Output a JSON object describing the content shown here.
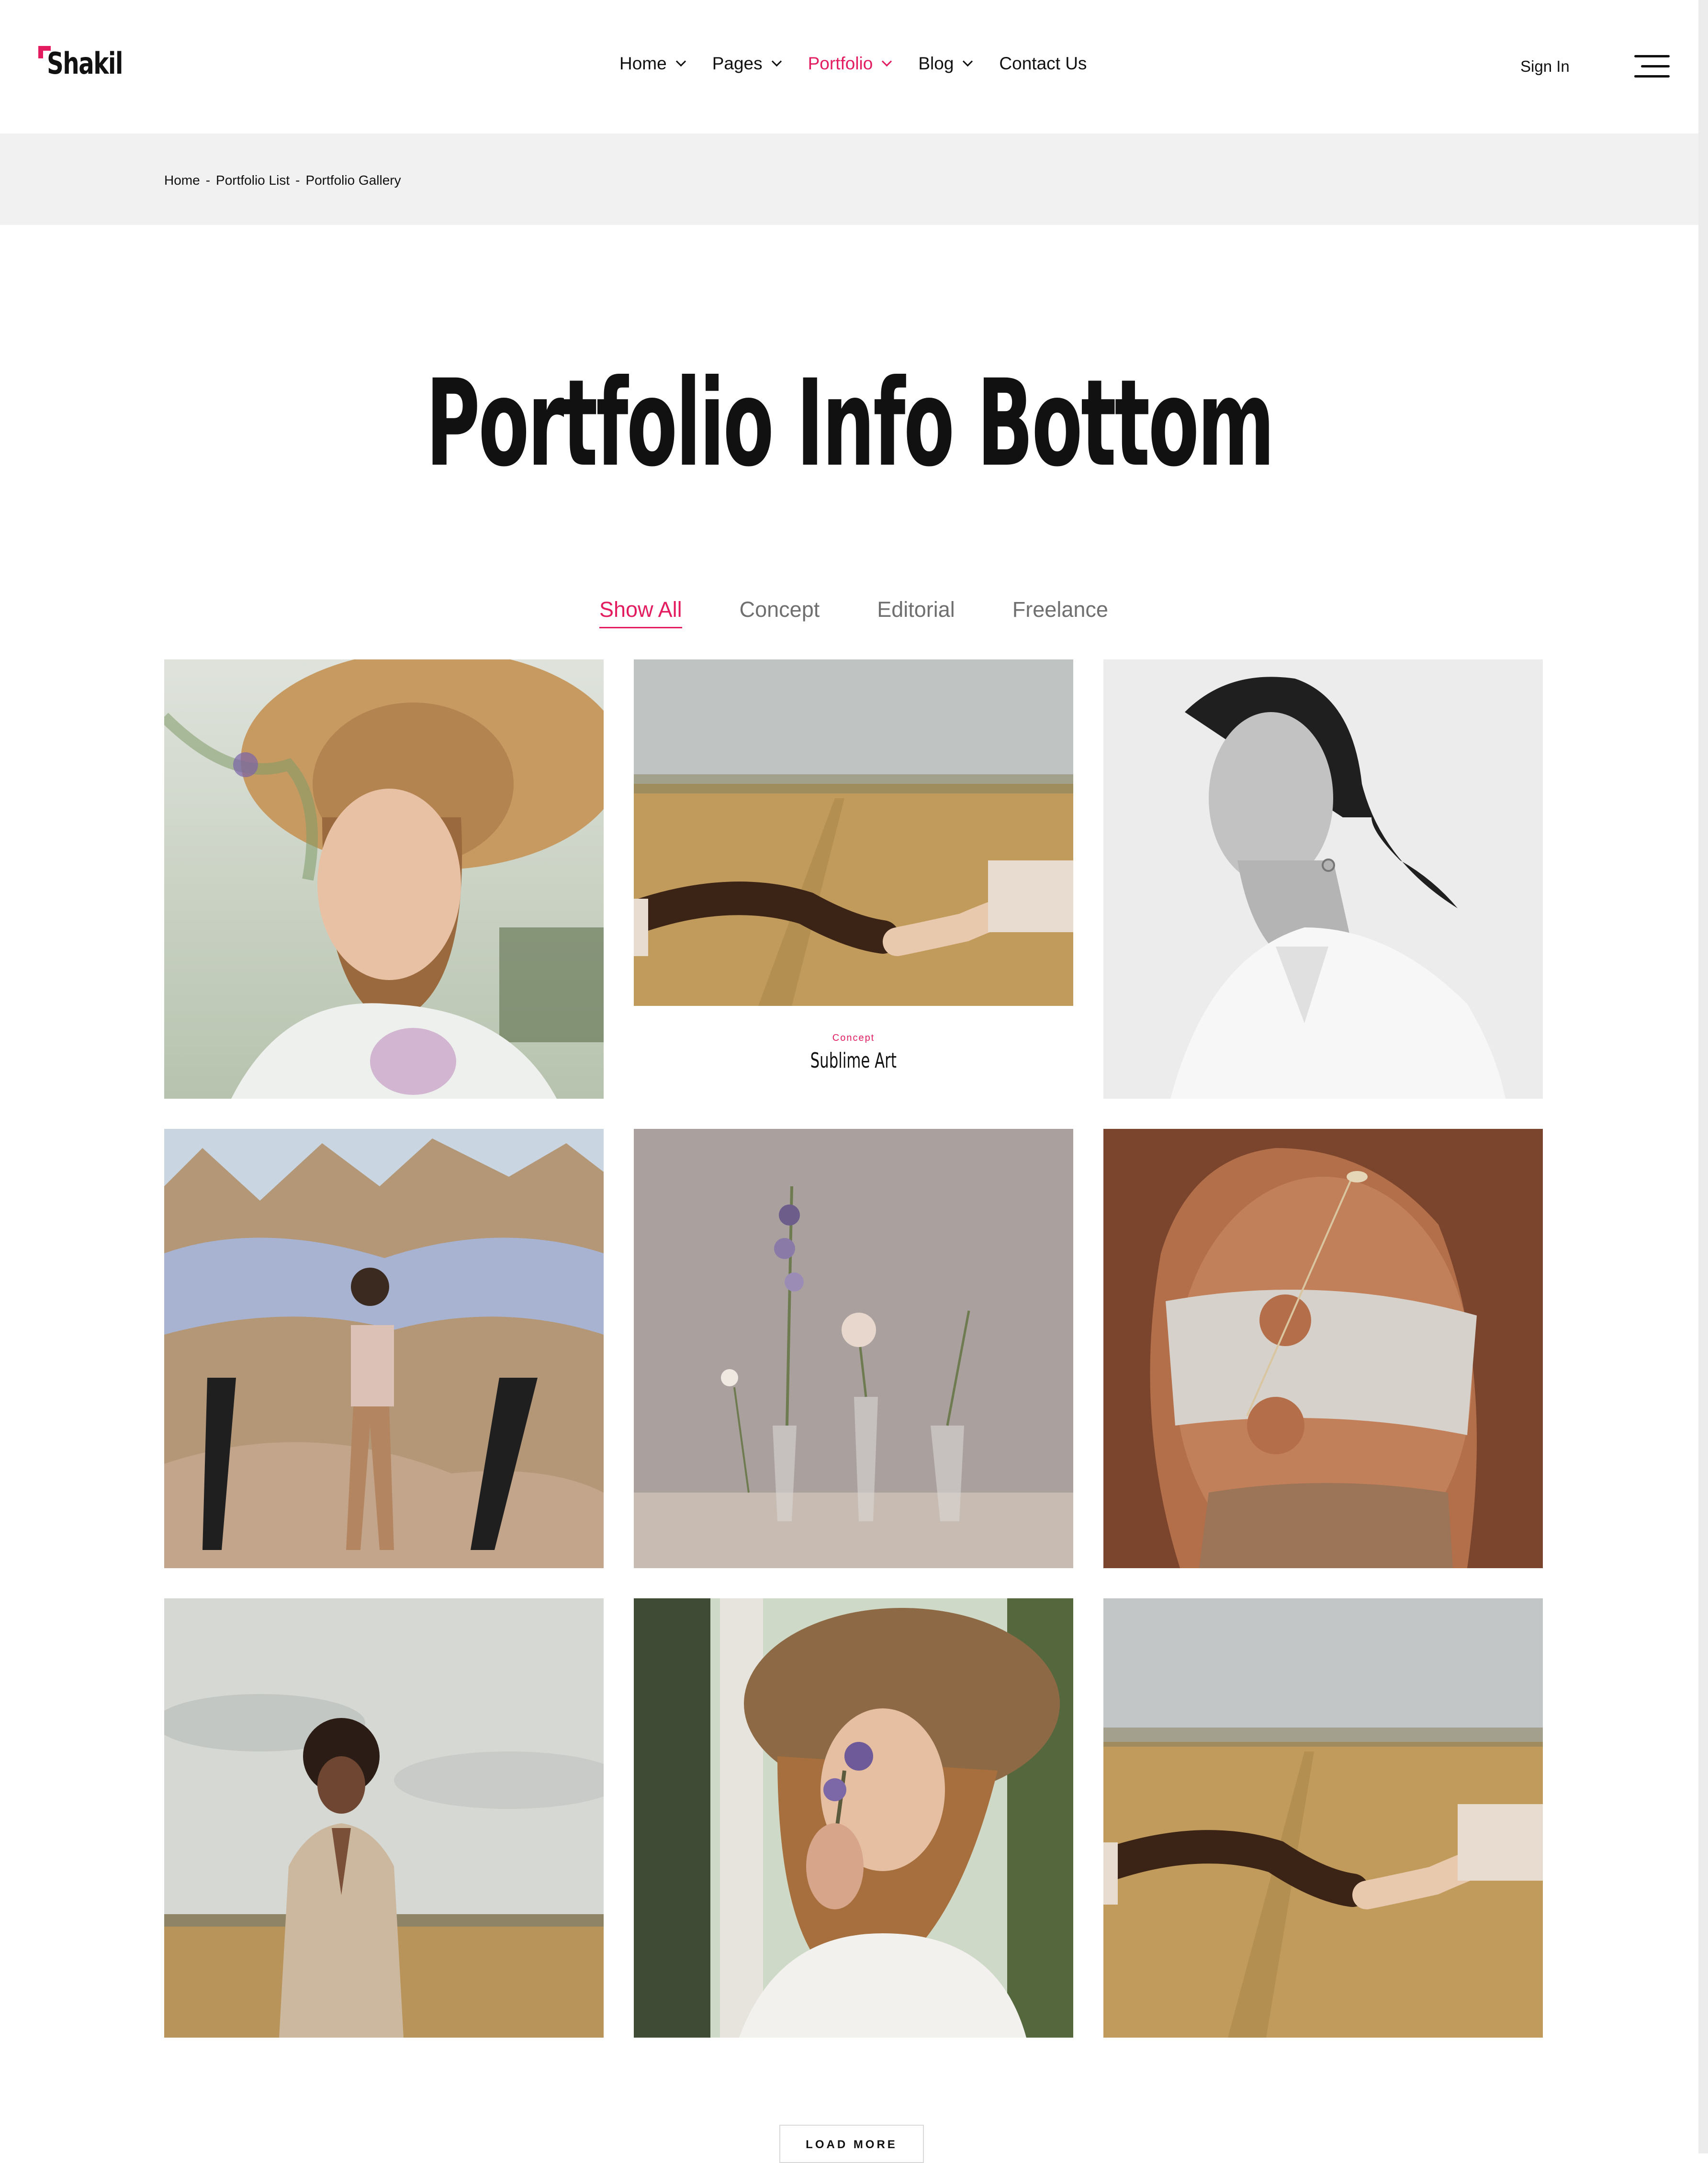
{
  "header": {
    "logo_text": "Shakil",
    "nav": [
      {
        "label": "Home",
        "has_dropdown": true,
        "active": false
      },
      {
        "label": "Pages",
        "has_dropdown": true,
        "active": false
      },
      {
        "label": "Portfolio",
        "has_dropdown": true,
        "active": true
      },
      {
        "label": "Blog",
        "has_dropdown": true,
        "active": false
      },
      {
        "label": "Contact Us",
        "has_dropdown": false,
        "active": false
      }
    ],
    "sign_in": "Sign In",
    "menu_icon": "hamburger-menu-icon"
  },
  "breadcrumb": {
    "items": [
      "Home",
      "Portfolio List",
      "Portfolio Gallery"
    ],
    "separator": "-"
  },
  "page_title": "Portfolio Info Bottom",
  "filters": {
    "items": [
      "Show All",
      "Concept",
      "Editorial",
      "Freelance"
    ],
    "active_index": 0
  },
  "gallery": {
    "hovered_item": {
      "category": "Concept",
      "title": "Sublime Art"
    }
  },
  "load_more_label": "LOAD MORE",
  "colors": {
    "accent": "#e31c5f",
    "text": "#111111",
    "muted": "#6f6f6f",
    "breadcrumb_bg": "#f1f1f1"
  }
}
